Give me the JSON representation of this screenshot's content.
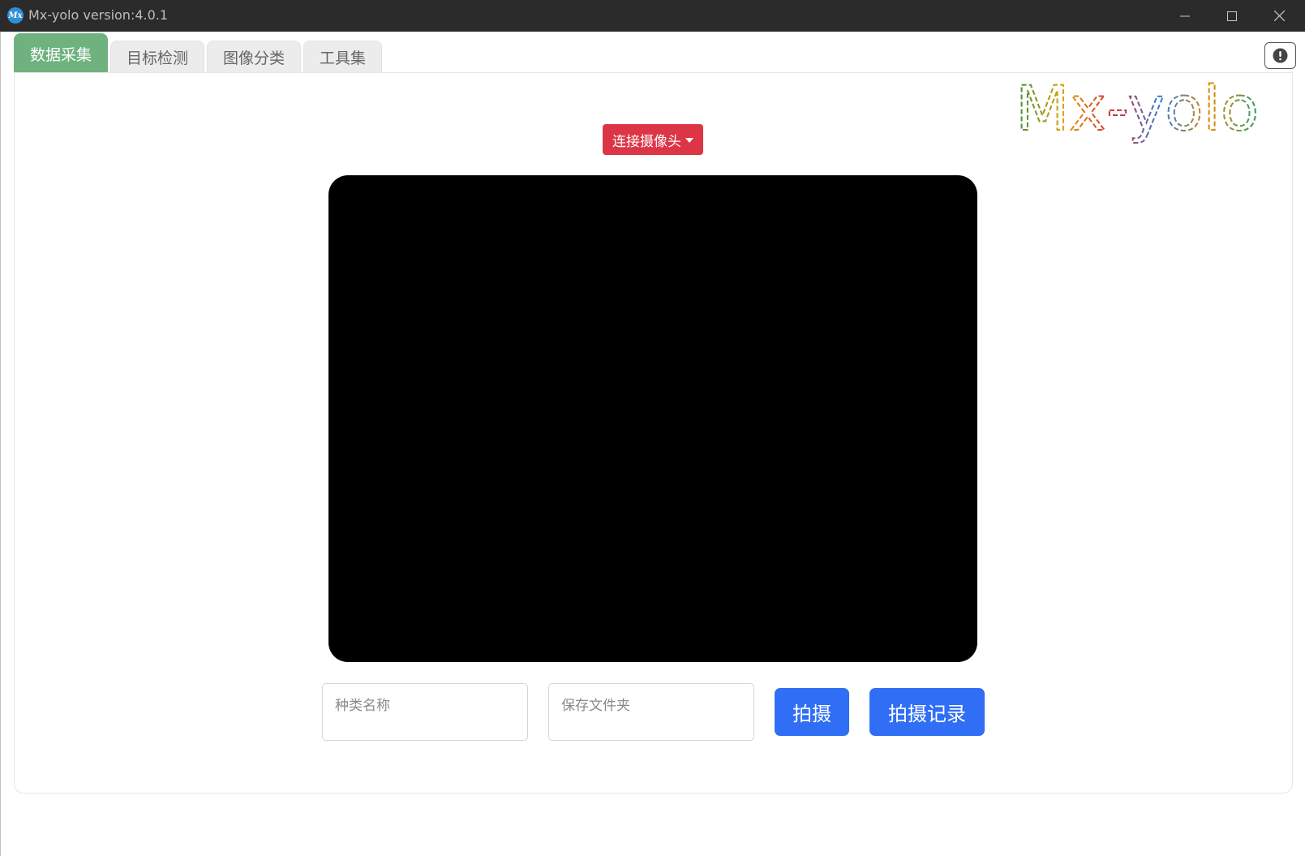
{
  "window": {
    "title": "Mx-yolo version:4.0.1",
    "icon_label": "Mx"
  },
  "tabs": [
    {
      "label": "数据采集",
      "active": true
    },
    {
      "label": "目标检测",
      "active": false
    },
    {
      "label": "图像分类",
      "active": false
    },
    {
      "label": "工具集",
      "active": false
    }
  ],
  "logo": {
    "text": "Mx-yolo"
  },
  "camera": {
    "button_label": "连接摄像头"
  },
  "form": {
    "class_name_placeholder": "种类名称",
    "save_folder_placeholder": "保存文件夹"
  },
  "actions": {
    "capture_label": "拍摄",
    "history_label": "拍摄记录"
  },
  "colors": {
    "active_tab": "#6fb27f",
    "camera_button": "#dc3545",
    "primary_button": "#2f6ef5",
    "titlebar": "#2b2b2b"
  }
}
